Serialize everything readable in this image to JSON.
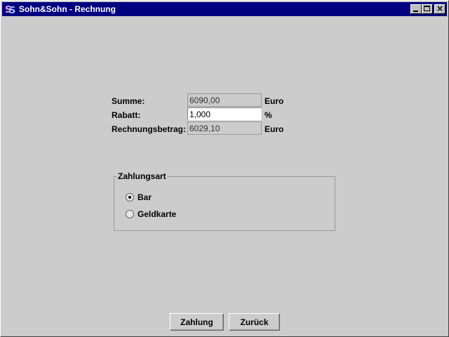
{
  "window": {
    "title": "Sohn&Sohn - Rechnung",
    "icon": "sohn-logo-icon"
  },
  "form": {
    "summe": {
      "label": "Summe:",
      "value": "6090,00",
      "unit": "Euro"
    },
    "rabatt": {
      "label": "Rabatt:",
      "value": "1,000",
      "unit": "%"
    },
    "rechnungsbetrag": {
      "label": "Rechnungsbetrag:",
      "value": "6029,10",
      "unit": "Euro"
    }
  },
  "zahlungsart": {
    "title": "Zahlungsart",
    "options": [
      {
        "label": "Bar",
        "selected": true
      },
      {
        "label": "Geldkarte",
        "selected": false
      }
    ]
  },
  "buttons": {
    "zahlung": "Zahlung",
    "zurueck": "Zurück"
  },
  "colors": {
    "titlebar": "#000080",
    "background": "#cccccc"
  }
}
